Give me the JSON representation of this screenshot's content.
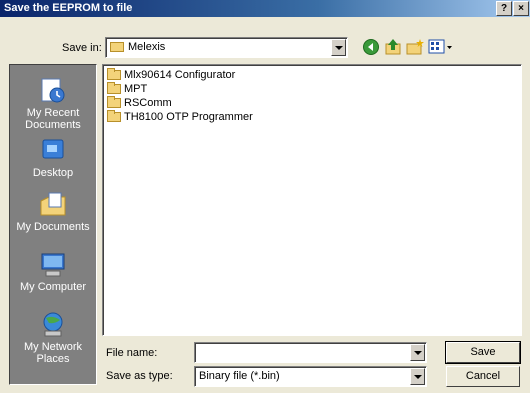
{
  "window": {
    "title": "Save the EEPROM to file",
    "help_label": "?",
    "close_label": "×"
  },
  "toolbar": {
    "save_in_label": "Save in:",
    "save_in_value": "Melexis",
    "icons": [
      "back-icon",
      "up-folder-icon",
      "new-folder-icon",
      "view-menu-icon"
    ]
  },
  "places": [
    {
      "label": "My Recent Documents",
      "icon": "recent-documents-icon"
    },
    {
      "label": "Desktop",
      "icon": "desktop-icon"
    },
    {
      "label": "My Documents",
      "icon": "my-documents-icon"
    },
    {
      "label": "My Computer",
      "icon": "my-computer-icon"
    },
    {
      "label": "My Network Places",
      "icon": "network-places-icon"
    }
  ],
  "files": [
    {
      "name": "Mlx90614 Configurator"
    },
    {
      "name": "MPT"
    },
    {
      "name": "RSComm"
    },
    {
      "name": "TH8100 OTP Programmer"
    }
  ],
  "form": {
    "file_name_label": "File name:",
    "file_name_value": "",
    "save_type_label": "Save as type:",
    "save_type_value": "Binary file (*.bin)",
    "save_button": "Save",
    "cancel_button": "Cancel"
  },
  "colors": {
    "title_start": "#0a246a",
    "title_end": "#a6caf0",
    "face": "#ece9d8",
    "places_bg": "#808080"
  }
}
